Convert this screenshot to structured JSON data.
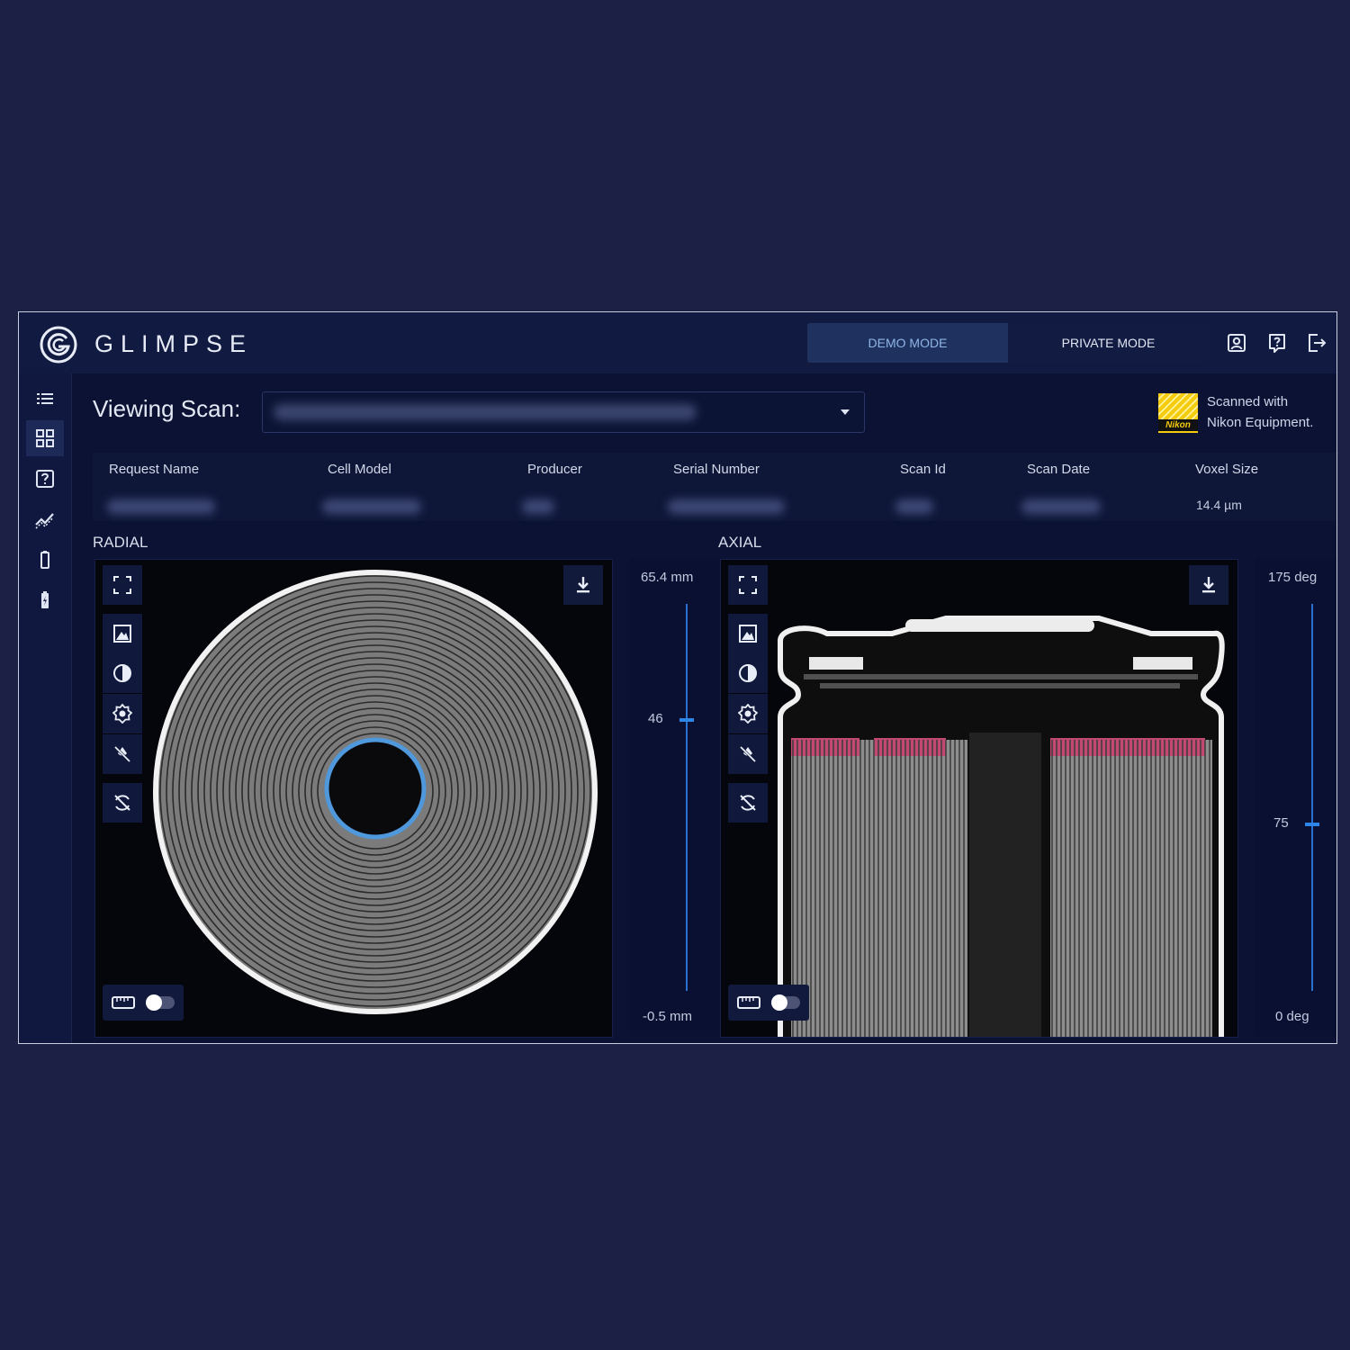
{
  "app": {
    "brand": "GLIMPSE"
  },
  "header": {
    "modes": [
      {
        "label": "DEMO MODE",
        "active": true
      },
      {
        "label": "PRIVATE MODE",
        "active": false
      }
    ],
    "icons": [
      "account-icon",
      "help-icon",
      "logout-icon"
    ]
  },
  "sidebar": {
    "items": [
      {
        "icon": "list-icon",
        "active": false
      },
      {
        "icon": "grid-icon",
        "active": true
      },
      {
        "icon": "help-box-icon",
        "active": false
      },
      {
        "icon": "chart-trend-icon",
        "active": false
      },
      {
        "icon": "battery-icon",
        "active": false
      },
      {
        "icon": "battery-charging-icon",
        "active": false
      }
    ]
  },
  "scan": {
    "viewing_label": "Viewing Scan:",
    "nikon_line1": "Scanned with",
    "nikon_line2": "Nikon Equipment.",
    "nikon_word": "Nikon"
  },
  "table": {
    "headers": [
      "Request Name",
      "Cell Model",
      "Producer",
      "Serial Number",
      "Scan Id",
      "Scan Date",
      "Voxel Size"
    ],
    "voxel_size": "14.4 µm"
  },
  "radial": {
    "title": "RADIAL",
    "slider_top": "65.4 mm",
    "slider_value": "46",
    "slider_bottom": "-0.5 mm",
    "slider_fraction": 0.7
  },
  "axial": {
    "title": "AXIAL",
    "slider_top": "175 deg",
    "slider_value": "75",
    "slider_bottom": "0 deg",
    "slider_fraction": 0.43
  },
  "colors": {
    "background": "#1c2044",
    "panel": "#0b1233",
    "accent": "#2e85e8",
    "demo_mode_text": "#8fb4e6"
  }
}
